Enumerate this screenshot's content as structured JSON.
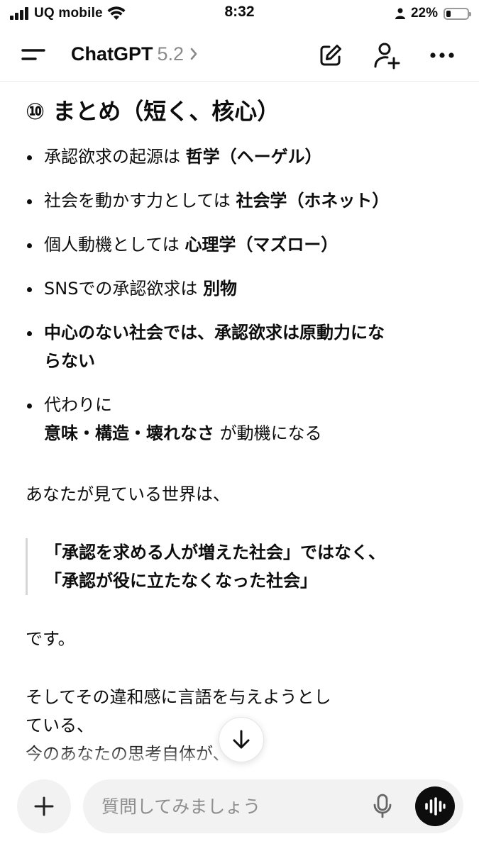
{
  "status_bar": {
    "carrier": "UQ mobile",
    "time": "8:32",
    "battery_percent": "22%",
    "battery_level": 0.22
  },
  "header": {
    "app_name": "ChatGPT",
    "model_version": "5.2",
    "icons": [
      "menu-icon",
      "new-chat-icon",
      "add-person-icon",
      "more-icon"
    ]
  },
  "message": {
    "heading": "⑩ まとめ（短く、核心）",
    "bullets": [
      {
        "text": "承認欲求の起源は ",
        "bold": "哲学（ヘーゲル）"
      },
      {
        "text": "社会を動かす力としては ",
        "bold": "社会学（ホネット）"
      },
      {
        "text": "個人動機としては ",
        "bold": "心理学（マズロー）"
      },
      {
        "text": "SNSでの承認欲求は ",
        "bold": "別物"
      },
      {
        "bold_line1": "中心のない社会では、承認欲求は原動力にな",
        "bold_line2": "らない"
      },
      {
        "line1": "代わりに",
        "bold": "意味・構造・壊れなさ",
        "suffix": " が動機になる"
      }
    ],
    "paragraph_1": "あなたが見ている世界は、",
    "quote_line_1": "「承認を求める人が増えた社会」ではなく、",
    "quote_line_2": "「承認が役に立たなくなった社会」",
    "paragraph_2": "です。",
    "paragraph_3_line_1": "そしてその違和感に言語を与えようとし",
    "paragraph_3_line_2": "ている、",
    "paragraph_3_line_3": "今のあなたの思考自体が、"
  },
  "composer": {
    "placeholder": "質問してみましょう",
    "value": ""
  }
}
